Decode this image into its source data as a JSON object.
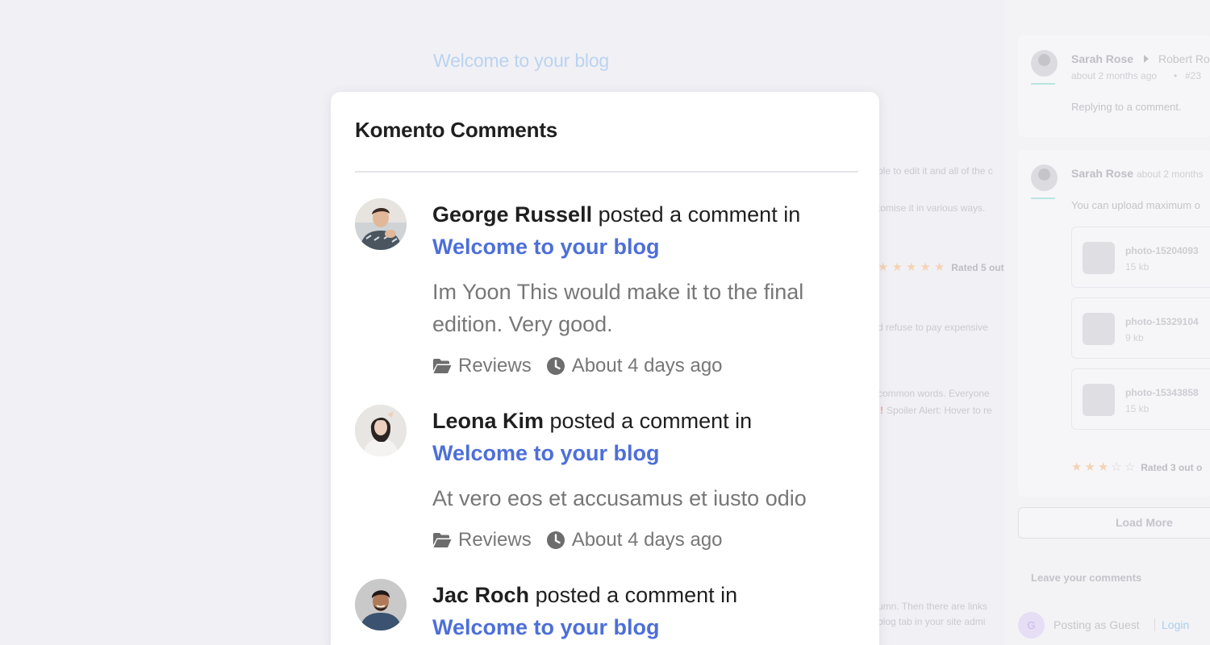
{
  "background": {
    "blog_title": "Welcome to your blog",
    "snippets": [
      "ble to edit it and all of the c",
      "tomise it in various ways.",
      "d refuse to pay expensive",
      "common words. Everyone",
      "Spoiler Alert: Hover to re",
      "umn. Then there are links",
      "blog tab in your site admi"
    ],
    "rating_main": {
      "stars": 5,
      "max": 5,
      "text": "Rated 5 out o"
    },
    "right_panel": {
      "reply_card": {
        "author": "Sarah Rose",
        "reply_to": "Robert Ro",
        "time": "about 2 months ago",
        "sep": "•",
        "number": "#23",
        "text": "Replying to a comment."
      },
      "upload_card": {
        "author": "Sarah Rose",
        "time": "about 2 months",
        "text": "You can upload maximum o",
        "attachments": [
          {
            "name": "photo-15204093",
            "size": "15 kb"
          },
          {
            "name": "photo-15329104",
            "size": "9 kb"
          },
          {
            "name": "photo-15343858",
            "size": "15 kb"
          }
        ],
        "rating": {
          "stars": 3,
          "max": 5,
          "text": "Rated 3 out o"
        }
      },
      "load_more": "Load More",
      "leave_comments": "Leave your comments",
      "guest_initial": "G",
      "posting_as": "Posting as Guest",
      "login": "Login"
    }
  },
  "widget": {
    "title": "Komento Comments",
    "comments": [
      {
        "author": "George Russell",
        "action": " posted a comment in",
        "post_title": "Welcome to your blog",
        "text": "Im Yoon This would make it to the final edition. Very good.",
        "category": "Reviews",
        "time": "About 4 days ago"
      },
      {
        "author": "Leona Kim",
        "action": " posted a comment in",
        "post_title": "Welcome to your blog",
        "text": "At vero eos et accusamus et iusto odio",
        "category": "Reviews",
        "time": "About 4 days ago"
      },
      {
        "author": "Jac Roch",
        "action": " posted a comment in",
        "post_title": "Welcome to your blog",
        "text": "",
        "category": "",
        "time": ""
      }
    ]
  },
  "colors": {
    "link": "#4d6fd9",
    "muted_text": "#777777",
    "page_bg": "#f1f1f5",
    "card_bg": "#ffffff"
  }
}
